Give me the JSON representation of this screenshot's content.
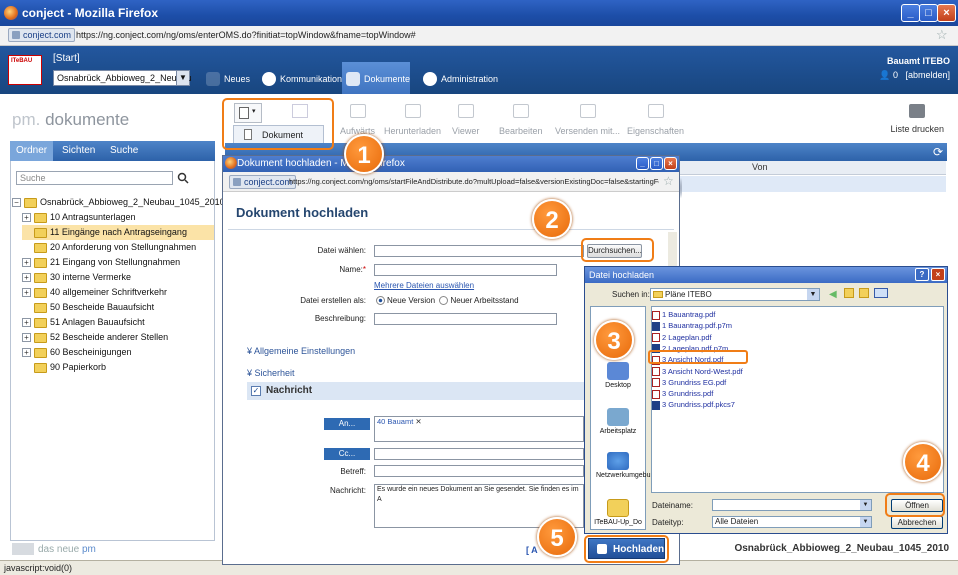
{
  "browser": {
    "title": "conject - Mozilla Firefox",
    "site_id": "conject.com",
    "url": "https://ng.conject.com/ng/oms/enterOMS.do?finitiat=topWindow&fname=topWindow#"
  },
  "app": {
    "start": "[Start]",
    "project": "Osnabrück_Abbioweg_2_Neubau",
    "nav": [
      {
        "label": "Neues"
      },
      {
        "label": "Kommunikation"
      },
      {
        "label": "Dokumente"
      },
      {
        "label": "Administration"
      }
    ],
    "org": "Bauamt ITEBO",
    "user_count": "0",
    "logout": "[abmelden]",
    "logo_text": "ITeBAU"
  },
  "page": {
    "title_prefix": "pm.",
    "title_rest": "dokumente",
    "toolbar": [
      {
        "label": "Aufwärts"
      },
      {
        "label": "Herunterladen"
      },
      {
        "label": "Viewer"
      },
      {
        "label": "Bearbeiten"
      },
      {
        "label": "Versenden mit..."
      },
      {
        "label": "Eigenschaften"
      }
    ],
    "print_label": "Liste drucken",
    "new_menu_item": "Dokument",
    "tabs": [
      {
        "label": "Ordner"
      },
      {
        "label": "Sichten"
      },
      {
        "label": "Suche"
      }
    ],
    "search_placeholder": "Suche",
    "tree_root": "Osnabrück_Abbioweg_2_Neubau_1045_2010",
    "tree": [
      {
        "label": "10 Antragsunterlagen",
        "pm": "+"
      },
      {
        "label": "11 Eingänge nach Antragseingang",
        "pm": ""
      },
      {
        "label": "20 Anforderung von Stellungnahmen",
        "pm": ""
      },
      {
        "label": "21 Eingang von Stellungnahmen",
        "pm": "+"
      },
      {
        "label": "30 interne Vermerke",
        "pm": "+"
      },
      {
        "label": "40 allgemeiner Schriftverkehr",
        "pm": "+"
      },
      {
        "label": "50 Bescheide Bauaufsicht",
        "pm": ""
      },
      {
        "label": "51 Anlagen Bauaufsicht",
        "pm": "+"
      },
      {
        "label": "52 Bescheide anderer Stellen",
        "pm": "+"
      },
      {
        "label": "60 Bescheinigungen",
        "pm": "+"
      },
      {
        "label": "90 Papierkorb",
        "pm": ""
      }
    ],
    "grid_col_von": "Von",
    "new_pm_label_a": "das neue",
    "new_pm_label_b": "pm",
    "bottom_path": "Osnabrück_Abbioweg_2_Neubau_1045_2010",
    "status": "javascript:void(0)"
  },
  "popup": {
    "title": "Dokument hochladen - Mozilla Firefox",
    "url": "https://ng.conject.com/ng/oms/startFileAndDistribute.do?multUpload=false&versionExistingDoc=false&startingForm",
    "heading": "Dokument hochladen",
    "file_label": "Datei wählen:",
    "browse": "Durchsuchen...",
    "name_label": "Name:",
    "multi_link": "Mehrere Dateien auswählen",
    "create_label": "Datei erstellen als:",
    "radio_new": "Neue Version",
    "radio_other": "Neuer Arbeitsstand",
    "desc_label": "Beschreibung:",
    "sec_general": "Allgemeine Einstellungen",
    "sec_security": "Sicherheit",
    "message_header": "Nachricht",
    "to_btn": "An...",
    "to_value": "40 Bauamt",
    "cc_btn": "Cc...",
    "subject_label": "Betreff:",
    "message_label": "Nachricht:",
    "message_text": "Es wurde ein neues Dokument an Sie gesendet. Sie finden es im A",
    "upload_btn": "Hochladen",
    "cancel_partial": "[ A"
  },
  "dialog": {
    "title": "Datei hochladen",
    "look_in": "Suchen in:",
    "folder": "Pläne ITEBO",
    "places": [
      {
        "label": "Desktop"
      },
      {
        "label": "Arbeitsplatz"
      },
      {
        "label": "Netzwerkumgebung"
      },
      {
        "label": "ITeBAU-Up_Do"
      }
    ],
    "files": [
      "1 Bauantrag.pdf",
      "1 Bauantrag.pdf.p7m",
      "2 Lageplan.pdf",
      "2 Lageplan.pdf.p7m",
      "3 Ansicht Nord.pdf",
      "3 Ansicht Nord-West.pdf",
      "3 Grundriss EG.pdf",
      "3 Grundriss.pdf",
      "3 Grundriss.pdf.pkcs7"
    ],
    "fname_label": "Dateiname:",
    "ftype_label": "Dateityp:",
    "ftype_value": "Alle Dateien",
    "open_btn": "Öffnen",
    "cancel_btn": "Abbrechen"
  },
  "callouts": [
    "1",
    "2",
    "3",
    "4",
    "5"
  ],
  "colors": {
    "brand_blue": "#23579f",
    "callout_orange": "#f07d17",
    "tree_highlight": "#fbe3a7"
  }
}
